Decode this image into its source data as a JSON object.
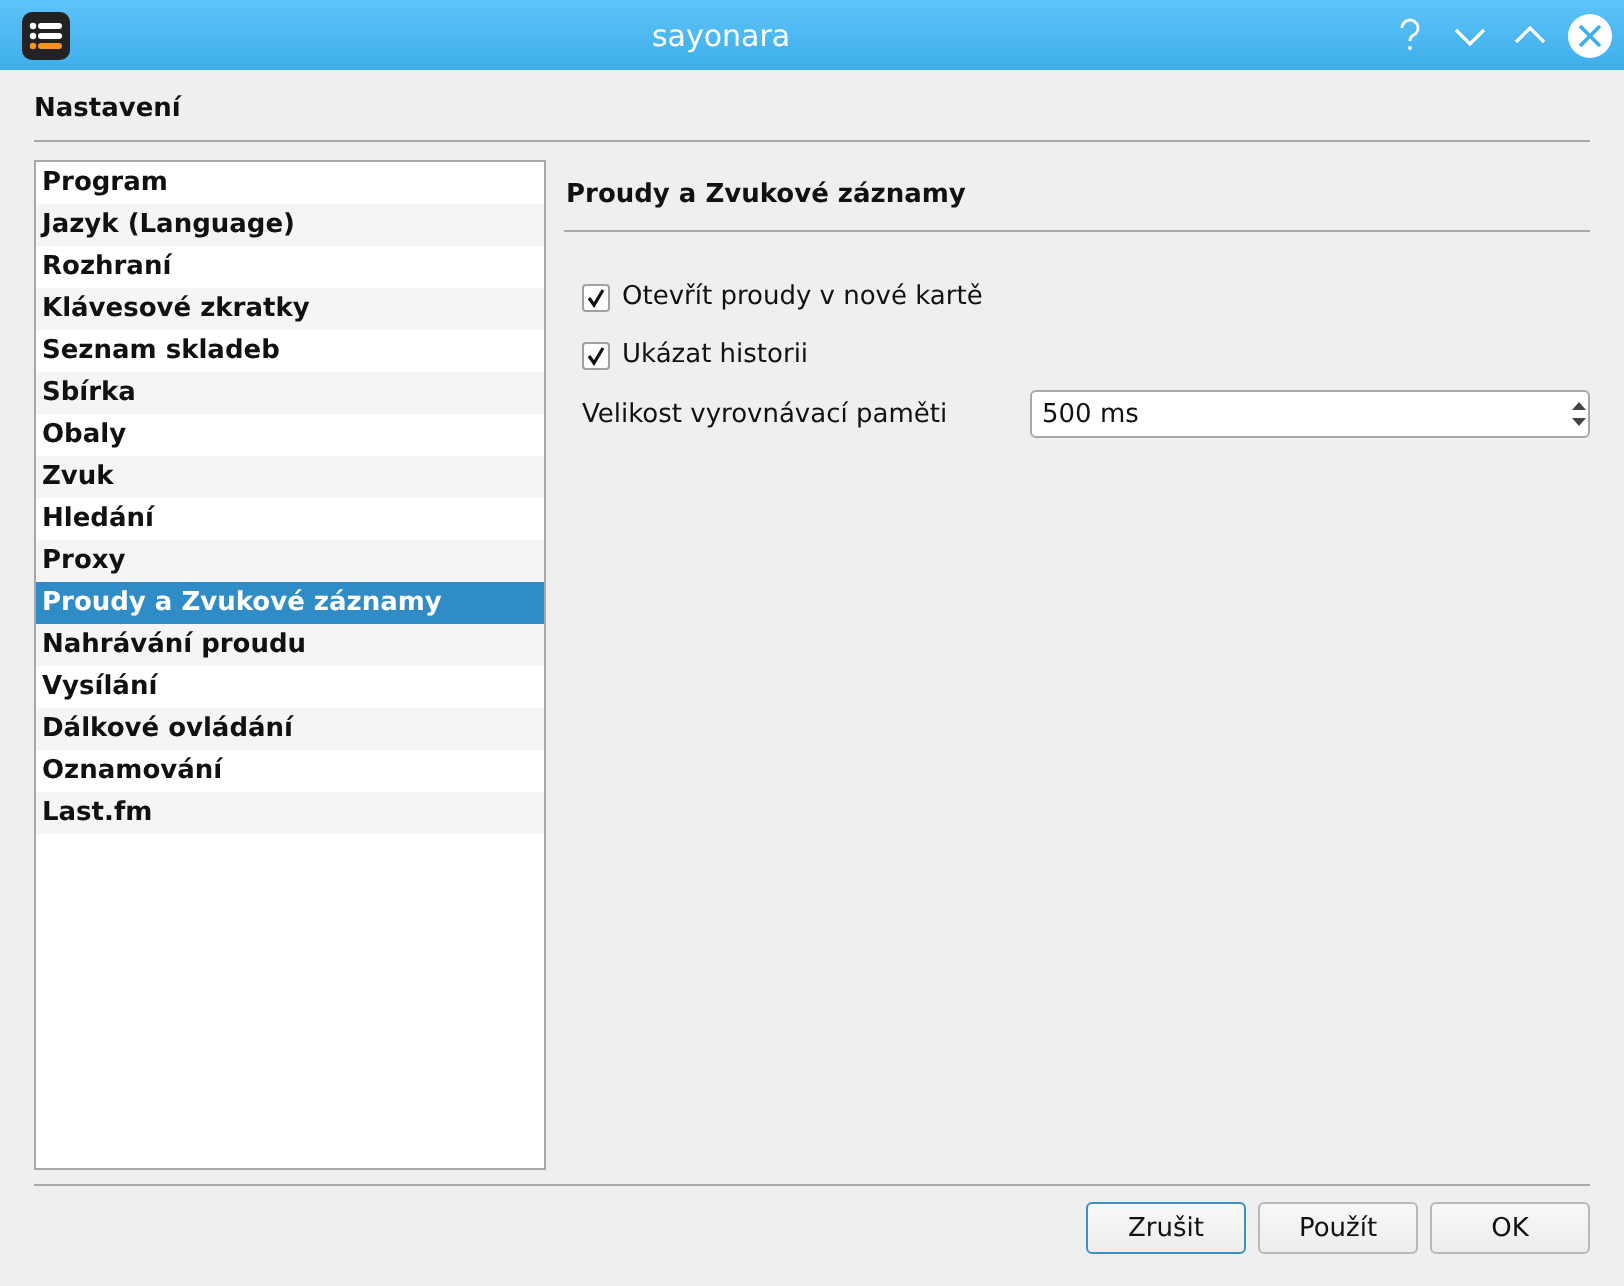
{
  "window": {
    "title": "sayonara"
  },
  "heading": "Nastavení",
  "sidebar": {
    "items": [
      {
        "label": "Program",
        "selected": false
      },
      {
        "label": "Jazyk (Language)",
        "selected": false
      },
      {
        "label": "Rozhraní",
        "selected": false
      },
      {
        "label": "Klávesové zkratky",
        "selected": false
      },
      {
        "label": "Seznam skladeb",
        "selected": false
      },
      {
        "label": "Sbírka",
        "selected": false
      },
      {
        "label": "Obaly",
        "selected": false
      },
      {
        "label": "Zvuk",
        "selected": false
      },
      {
        "label": "Hledání",
        "selected": false
      },
      {
        "label": "Proxy",
        "selected": false
      },
      {
        "label": "Proudy a Zvukové záznamy",
        "selected": true
      },
      {
        "label": "Nahrávání proudu",
        "selected": false
      },
      {
        "label": "Vysílání",
        "selected": false
      },
      {
        "label": "Dálkové ovládání",
        "selected": false
      },
      {
        "label": "Oznamování",
        "selected": false
      },
      {
        "label": "Last.fm",
        "selected": false
      }
    ]
  },
  "page": {
    "title": "Proudy a Zvukové záznamy",
    "options": [
      {
        "kind": "checkbox",
        "label": "Otevřít proudy v nové kartě",
        "checked": true
      },
      {
        "kind": "checkbox",
        "label": "Ukázat historii",
        "checked": true
      },
      {
        "kind": "spinbox",
        "label": "Velikost vyrovnávací paměti",
        "value": "500 ms"
      }
    ]
  },
  "buttons": [
    {
      "label": "Zrušit",
      "focused": true
    },
    {
      "label": "Použít",
      "focused": false
    },
    {
      "label": "OK",
      "focused": false
    }
  ]
}
